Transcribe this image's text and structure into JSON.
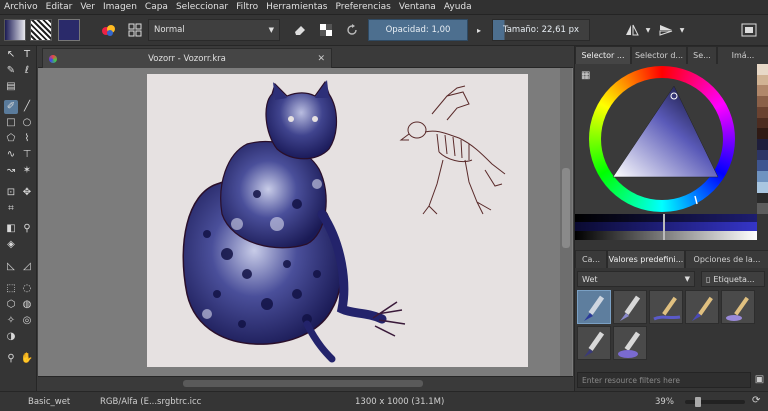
{
  "menu": [
    "Archivo",
    "Editar",
    "Ver",
    "Imagen",
    "Capa",
    "Seleccionar",
    "Filtro",
    "Herramientas",
    "Preferencias",
    "Ventana",
    "Ayuda"
  ],
  "toolbar": {
    "blend_mode": "Normal",
    "opacity_label": "Opacidad:",
    "opacity_value": "1,00",
    "size_label": "Tamaño:",
    "size_value": "22,61 px"
  },
  "document": {
    "tab_title": "Vozorr - Vozorr.kra",
    "close_glyph": "✕"
  },
  "docker_tabs_top": [
    "Selector ...",
    "Selector d...",
    "Se...",
    "Imá..."
  ],
  "docker_tabs_presets": [
    "Ca...",
    "Valores predefini...",
    "Opciones de la..."
  ],
  "presets": {
    "tag_value": "Wet",
    "tag_button": "Etiqueta...",
    "filter_placeholder": "Enter resource filters here"
  },
  "status": {
    "preset": "Basic_wet",
    "color_space": "RGB/Alfa (E...srgbtrc.icc",
    "image_size": "1300 x 1000 (31.1M)",
    "zoom": "39%"
  },
  "colors": {
    "accent": "#5a7b9b",
    "ink": "#23236b",
    "palette": [
      "#e8d9c8",
      "#d1b394",
      "#b0876a",
      "#8a6048",
      "#6a4230",
      "#4c2c20",
      "#2f1a14",
      "#1e1e3c",
      "#2c3566",
      "#3e5590",
      "#6f93c0",
      "#a9c6e0",
      "#2b2b2b",
      "#5d5d5d"
    ]
  },
  "icons": [
    "freehand-brush-icon",
    "line-icon",
    "rectangle-icon",
    "ellipse-icon",
    "text-icon",
    "move-icon",
    "crop-icon",
    "eyedropper-icon",
    "fill-icon",
    "zoom-icon",
    "pan-icon",
    "eraser-icon",
    "mirror-icon"
  ]
}
